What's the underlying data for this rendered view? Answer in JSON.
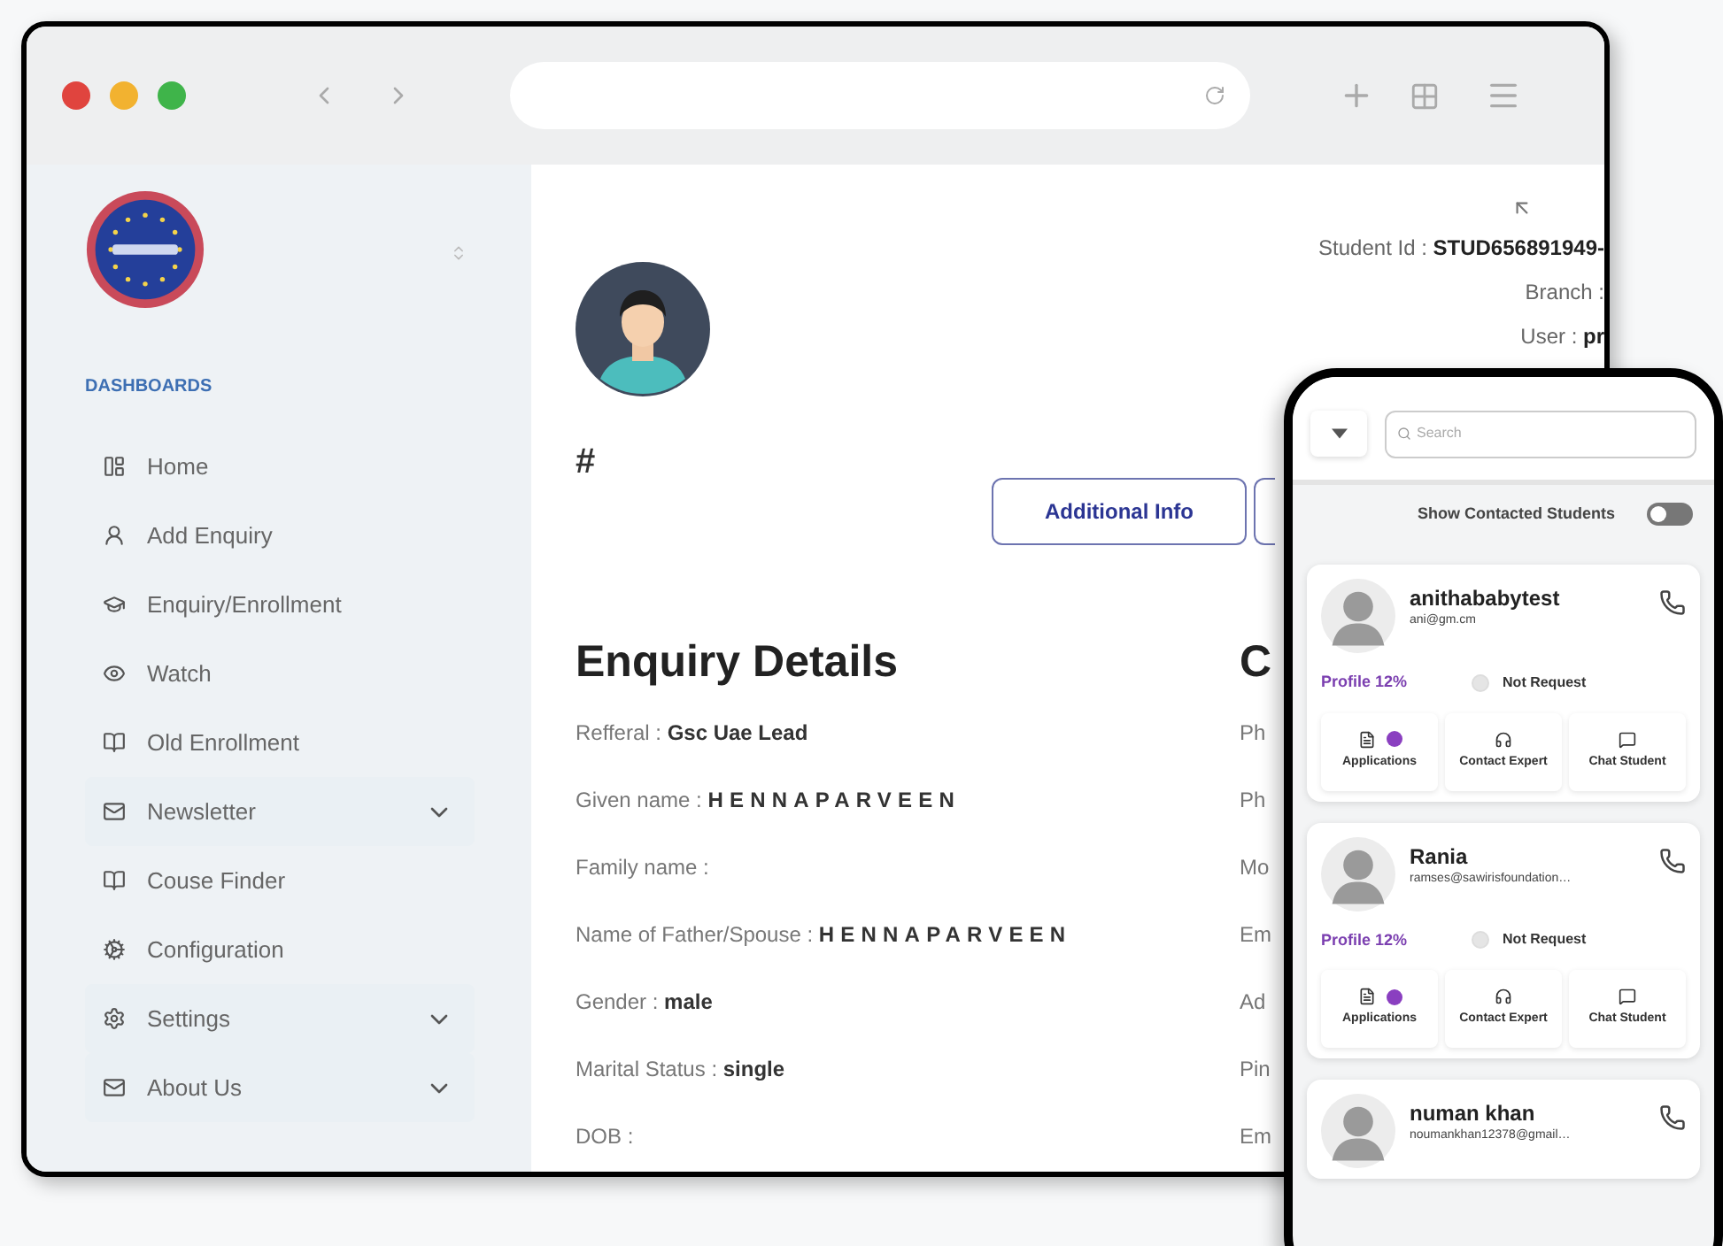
{
  "sidebar": {
    "section_label": "DASHBOARDS",
    "items": [
      {
        "label": "Home",
        "kind": "link"
      },
      {
        "label": "Add Enquiry",
        "kind": "link"
      },
      {
        "label": "Enquiry/Enrollment",
        "kind": "link"
      },
      {
        "label": "Watch",
        "kind": "link"
      },
      {
        "label": "Old Enrollment",
        "kind": "link"
      },
      {
        "label": "Newsletter",
        "kind": "group",
        "expanded": false
      },
      {
        "label": "Couse Finder",
        "kind": "link"
      },
      {
        "label": "Configuration",
        "kind": "link"
      },
      {
        "label": "Settings",
        "kind": "group",
        "expanded": false
      },
      {
        "label": "About Us",
        "kind": "group",
        "expanded": false
      }
    ]
  },
  "profile": {
    "name": "#",
    "info": [
      {
        "label": "Student Id : ",
        "value": "STUD656891949-"
      },
      {
        "label": "Branch :"
      },
      {
        "label": "User : ",
        "value": "pr"
      }
    ],
    "buttons": [
      "Additional Info"
    ]
  },
  "enquiry_details": {
    "title": "Enquiry Details",
    "fields": [
      {
        "label": "Refferal : ",
        "value": "Gsc Uae Lead",
        "spaced": false
      },
      {
        "label": "Given name : ",
        "value": "HENNAPARVEEN",
        "spaced": true
      },
      {
        "label": "Family name :"
      },
      {
        "label": "Name of Father/Spouse : ",
        "value": "HENNAPARVEEN",
        "spaced": true
      },
      {
        "label": "Gender : ",
        "value": "male",
        "spaced": false
      },
      {
        "label": "Marital Status : ",
        "value": "single",
        "spaced": false
      },
      {
        "label": "DOB :"
      }
    ]
  },
  "contact_column": {
    "title": "C",
    "fields": [
      "Ph",
      "Ph",
      "Mo",
      "Em",
      "Ad",
      "Pin",
      "Em"
    ]
  },
  "phone": {
    "search_placeholder": "Search",
    "toggle": {
      "label": "Show Contacted Students",
      "on": false
    },
    "students": [
      {
        "name": "anithababytest",
        "email": "ani@gm.cm",
        "profile": "Profile 12%",
        "request": "Not Request",
        "request_checked": false,
        "actions": [
          "Applications",
          "Contact Expert",
          "Chat Student"
        ]
      },
      {
        "name": "Rania",
        "email": "ramses@sawirisfoundation…",
        "profile": "Profile 12%",
        "request": "Not Request",
        "request_checked": false,
        "actions": [
          "Applications",
          "Contact Expert",
          "Chat Student"
        ]
      },
      {
        "name": "numan khan",
        "email": "noumankhan12378@gmail…"
      }
    ]
  }
}
